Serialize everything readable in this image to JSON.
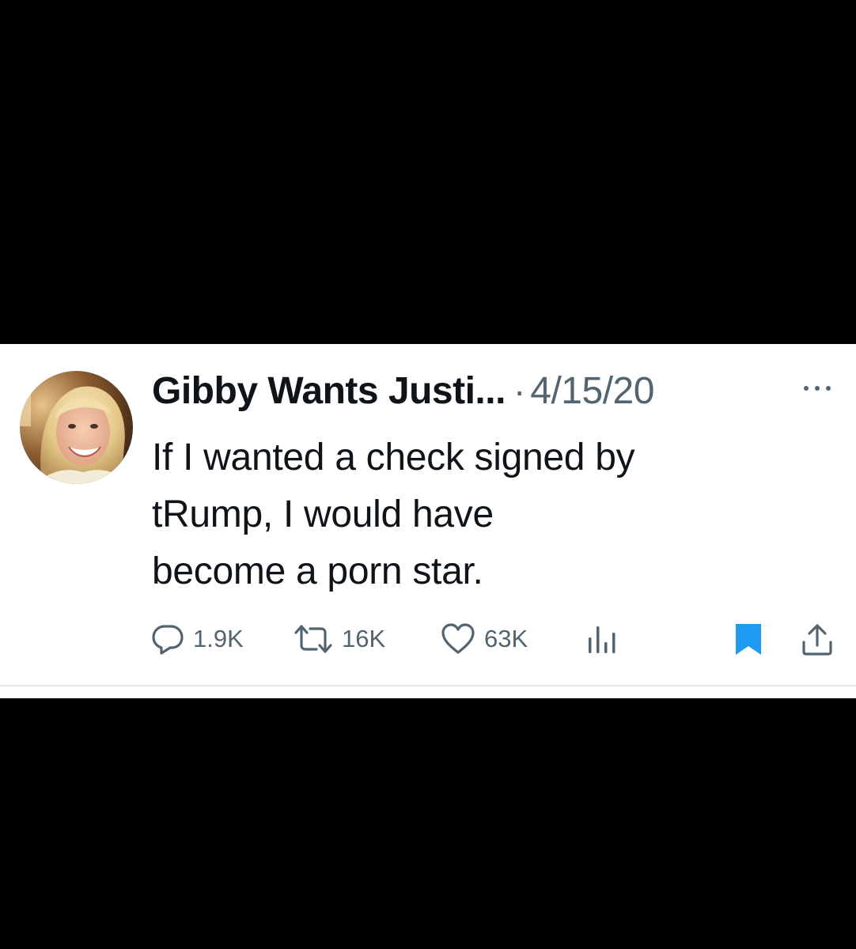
{
  "tweet": {
    "display_name": "Gibby Wants Justi...",
    "separator": "·",
    "date": "4/15/20",
    "text": "If I wanted a check signed by\ntRump, I would have\nbecome a porn star."
  },
  "actions": {
    "reply": {
      "icon": "reply-icon",
      "count": "1.9K"
    },
    "retweet": {
      "icon": "retweet-icon",
      "count": "16K"
    },
    "like": {
      "icon": "heart-icon",
      "count": "63K"
    },
    "views": {
      "icon": "views-chart-icon"
    },
    "bookmark": {
      "icon": "bookmark-icon",
      "active": true
    },
    "share": {
      "icon": "share-icon"
    }
  },
  "colors": {
    "text_primary": "#0f1419",
    "text_secondary": "#536471",
    "bookmark_active": "#1d9bf0",
    "background_card": "#ffffff",
    "background_page": "#000000"
  }
}
